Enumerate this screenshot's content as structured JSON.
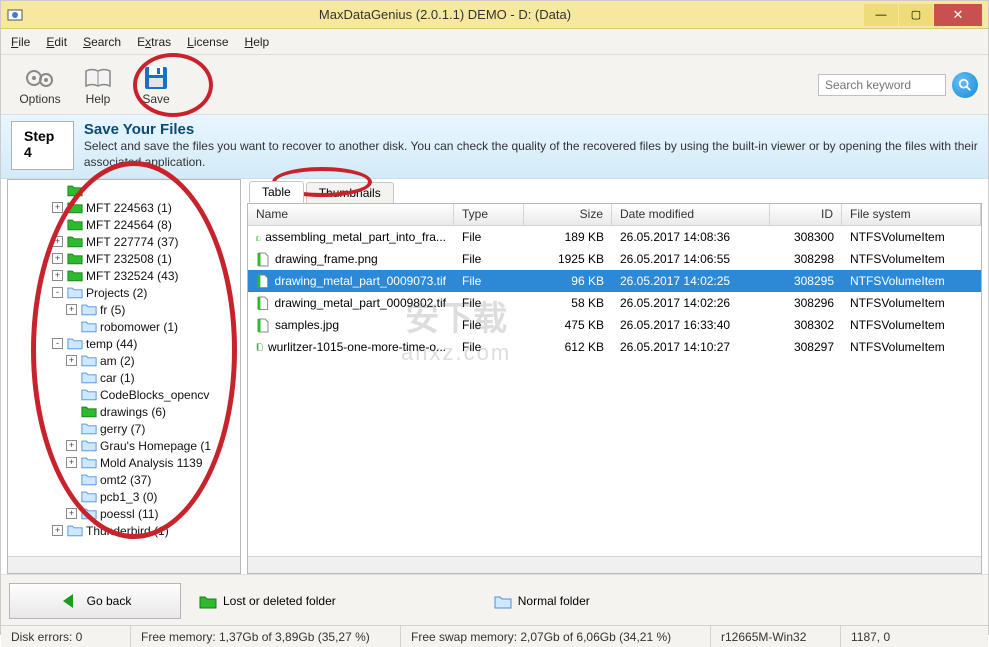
{
  "window": {
    "title": "MaxDataGenius (2.0.1.1) DEMO - D: (Data)"
  },
  "menu": {
    "file": "File",
    "edit": "Edit",
    "search": "Search",
    "extras": "Extras",
    "license": "License",
    "help": "Help"
  },
  "toolbar": {
    "options": "Options",
    "help": "Help",
    "save": "Save"
  },
  "search": {
    "placeholder": "Search keyword"
  },
  "banner": {
    "step": "Step 4",
    "heading": "Save Your Files",
    "desc": "Select and save the files you want to recover to another disk. You can check the quality of the recovered files by using the built-in viewer or by opening the files with their associated application."
  },
  "tree": [
    {
      "depth": 3,
      "exp": "",
      "green": true,
      "label": ""
    },
    {
      "depth": 3,
      "exp": "+",
      "green": true,
      "label": "MFT 224563 (1)"
    },
    {
      "depth": 3,
      "exp": "",
      "green": true,
      "label": "MFT 224564 (8)"
    },
    {
      "depth": 3,
      "exp": "+",
      "green": true,
      "label": "MFT 227774 (37)"
    },
    {
      "depth": 3,
      "exp": "+",
      "green": true,
      "label": "MFT 232508 (1)"
    },
    {
      "depth": 3,
      "exp": "+",
      "green": true,
      "label": "MFT 232524 (43)"
    },
    {
      "depth": 3,
      "exp": "-",
      "green": false,
      "label": "Projects (2)"
    },
    {
      "depth": 4,
      "exp": "+",
      "green": false,
      "label": "fr (5)"
    },
    {
      "depth": 4,
      "exp": "",
      "green": false,
      "label": "robomower (1)"
    },
    {
      "depth": 3,
      "exp": "-",
      "green": false,
      "label": "temp (44)"
    },
    {
      "depth": 4,
      "exp": "+",
      "green": false,
      "label": "am (2)"
    },
    {
      "depth": 4,
      "exp": "",
      "green": false,
      "label": "car (1)"
    },
    {
      "depth": 4,
      "exp": "",
      "green": false,
      "label": "CodeBlocks_opencv"
    },
    {
      "depth": 4,
      "exp": "",
      "green": true,
      "label": "drawings (6)"
    },
    {
      "depth": 4,
      "exp": "",
      "green": false,
      "label": "gerry (7)"
    },
    {
      "depth": 4,
      "exp": "+",
      "green": false,
      "label": "Grau's Homepage (1"
    },
    {
      "depth": 4,
      "exp": "+",
      "green": false,
      "label": "Mold Analysis 1139"
    },
    {
      "depth": 4,
      "exp": "",
      "green": false,
      "label": "omt2 (37)"
    },
    {
      "depth": 4,
      "exp": "",
      "green": false,
      "label": "pcb1_3 (0)"
    },
    {
      "depth": 4,
      "exp": "+",
      "green": false,
      "label": "poessl (11)"
    },
    {
      "depth": 3,
      "exp": "+",
      "green": false,
      "label": "Thunderbird (1)"
    }
  ],
  "tabs": {
    "table": "Table",
    "thumbnails": "Thumbnails"
  },
  "columns": {
    "name": "Name",
    "type": "Type",
    "size": "Size",
    "date": "Date modified",
    "id": "ID",
    "fs": "File system"
  },
  "colw": {
    "name": 206,
    "type": 70,
    "size": 88,
    "date": 158,
    "id": 72,
    "fs": 96
  },
  "rows": [
    {
      "name": "assembling_metal_part_into_fra...",
      "type": "File",
      "size": "189 KB",
      "date": "26.05.2017 14:08:36",
      "id": "308300",
      "fs": "NTFSVolumeItem",
      "sel": false
    },
    {
      "name": "drawing_frame.png",
      "type": "File",
      "size": "1925 KB",
      "date": "26.05.2017 14:06:55",
      "id": "308298",
      "fs": "NTFSVolumeItem",
      "sel": false
    },
    {
      "name": "drawing_metal_part_0009073.tif",
      "type": "File",
      "size": "96 KB",
      "date": "26.05.2017 14:02:25",
      "id": "308295",
      "fs": "NTFSVolumeItem",
      "sel": true
    },
    {
      "name": "drawing_metal_part_0009802.tif",
      "type": "File",
      "size": "58 KB",
      "date": "26.05.2017 14:02:26",
      "id": "308296",
      "fs": "NTFSVolumeItem",
      "sel": false
    },
    {
      "name": "samples.jpg",
      "type": "File",
      "size": "475 KB",
      "date": "26.05.2017 16:33:40",
      "id": "308302",
      "fs": "NTFSVolumeItem",
      "sel": false
    },
    {
      "name": "wurlitzer-1015-one-more-time-o...",
      "type": "File",
      "size": "612 KB",
      "date": "26.05.2017 14:10:27",
      "id": "308297",
      "fs": "NTFSVolumeItem",
      "sel": false
    }
  ],
  "bottom": {
    "goback": "Go back",
    "lost": "Lost or deleted folder",
    "normal": "Normal folder"
  },
  "status": {
    "diskerrors": "Disk errors: 0",
    "freemem": "Free memory: 1,37Gb of 3,89Gb (35,27 %)",
    "freeswap": "Free swap memory: 2,07Gb of 6,06Gb (34,21 %)",
    "host": "r12665M-Win32",
    "extra": "1187, 0"
  },
  "watermark": {
    "line1": "安下载",
    "line2": "anxz.com"
  }
}
